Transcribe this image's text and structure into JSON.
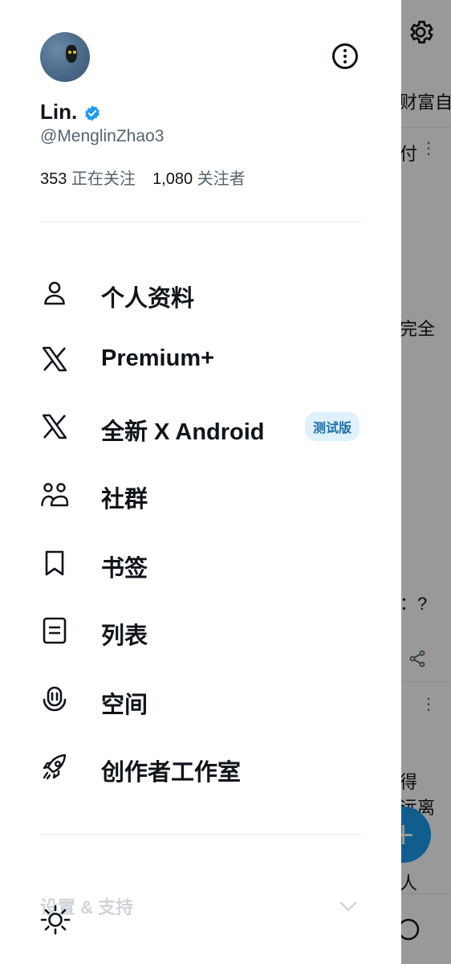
{
  "profile": {
    "display_name": "Lin.",
    "handle": "@MenglinZhao3",
    "following_count": "353",
    "following_label": "正在关注",
    "followers_count": "1,080",
    "followers_label": "关注者",
    "verified_color": "#1d9bf0"
  },
  "menu": {
    "items": [
      {
        "label": "个人资料",
        "icon": "person-icon"
      },
      {
        "label": "Premium+",
        "icon": "x-logo-icon"
      },
      {
        "label": "全新 X Android",
        "icon": "x-logo-icon",
        "badge": "测试版"
      },
      {
        "label": "社群",
        "icon": "communities-icon"
      },
      {
        "label": "书签",
        "icon": "bookmark-icon"
      },
      {
        "label": "列表",
        "icon": "list-icon"
      },
      {
        "label": "空间",
        "icon": "spaces-icon"
      },
      {
        "label": "创作者工作室",
        "icon": "rocket-icon"
      }
    ]
  },
  "settings": {
    "label": "设置 & 支持"
  },
  "background": {
    "text_1": "财富自",
    "text_2": "付",
    "text_3": "完全",
    "text_4": "：?",
    "text_5": "得",
    "text_6": "远离",
    "text_7": "人"
  },
  "colors": {
    "accent": "#1d9bf0",
    "beta_bg": "#dff1fd",
    "text_primary": "#0f1419",
    "text_secondary": "#536471"
  }
}
